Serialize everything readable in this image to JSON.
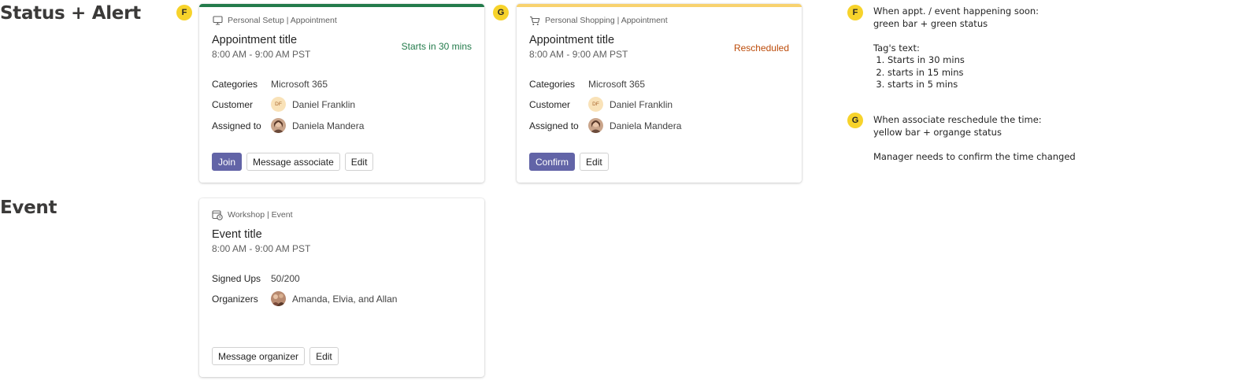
{
  "sections": {
    "status_alert": "Status + Alert",
    "event": "Event"
  },
  "markers": {
    "f": "F",
    "g": "G"
  },
  "cards": {
    "setup": {
      "meta": "Personal Setup | Appointment",
      "title": "Appointment title",
      "time": "8:00 AM - 9:00 AM PST",
      "status": "Starts in 30 mins",
      "bar_color": "#237b4b",
      "rows": [
        {
          "label": "Categories",
          "value": "Microsoft 365"
        },
        {
          "label": "Customer",
          "value": "Daniel Franklin",
          "initials": "DF"
        },
        {
          "label": "Assigned to",
          "value": "Daniela Mandera"
        }
      ],
      "buttons": [
        "Join",
        "Message associate",
        "Edit"
      ]
    },
    "shopping": {
      "meta": "Personal Shopping | Appointment",
      "title": "Appointment title",
      "time": "8:00 AM - 9:00 AM PST",
      "status": "Rescheduled",
      "bar_color": "#f8d26f",
      "rows": [
        {
          "label": "Categories",
          "value": "Microsoft 365"
        },
        {
          "label": "Customer",
          "value": "Daniel Franklin",
          "initials": "DF"
        },
        {
          "label": "Assigned to",
          "value": "Daniela Mandera"
        }
      ],
      "buttons": [
        "Confirm",
        "Edit"
      ]
    },
    "event": {
      "meta": "Workshop | Event",
      "title": "Event title",
      "time": "8:00 AM - 9:00 AM PST",
      "rows": [
        {
          "label": "Signed Ups",
          "value": "50/200"
        },
        {
          "label": "Organizers",
          "value": "Amanda, Elvia, and Allan"
        }
      ],
      "buttons": [
        "Message organizer",
        "Edit"
      ]
    }
  },
  "notes": {
    "f": {
      "line1": "When appt. / event happening soon:",
      "line2": "green bar + green status",
      "tag_heading": "Tag's text:",
      "items": [
        "Starts in 30 mins",
        "starts in 15 mins",
        "starts in 5 mins"
      ]
    },
    "g": {
      "line1": "When associate reschedule the time:",
      "line2": "yellow bar + organge status",
      "line3": "Manager needs to confirm the time changed"
    }
  }
}
